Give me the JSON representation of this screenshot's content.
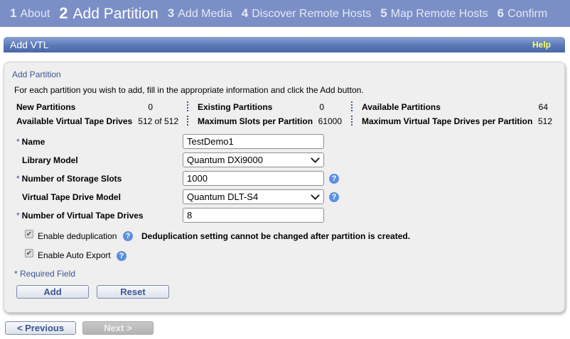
{
  "wizard": {
    "steps": [
      {
        "num": "1",
        "label": "About"
      },
      {
        "num": "2",
        "label": "Add Partition"
      },
      {
        "num": "3",
        "label": "Add Media"
      },
      {
        "num": "4",
        "label": "Discover Remote Hosts"
      },
      {
        "num": "5",
        "label": "Map Remote Hosts"
      },
      {
        "num": "6",
        "label": "Confirm"
      }
    ],
    "active_step": 2
  },
  "titlebar": {
    "title": "Add VTL",
    "help": "Help"
  },
  "panel": {
    "section_title": "Add Partition",
    "intro": "For each partition you wish to add, fill in the appropriate information and click the Add button."
  },
  "summary": {
    "new_partitions_label": "New Partitions",
    "new_partitions_value": "0",
    "existing_partitions_label": "Existing Partitions",
    "existing_partitions_value": "0",
    "available_partitions_label": "Available Partitions",
    "available_partitions_value": "64",
    "available_drives_label": "Available Virtual Tape Drives",
    "available_drives_value": "512 of 512",
    "max_slots_label": "Maximum Slots per Partition",
    "max_slots_value": "61000",
    "max_drives_label": "Maximum Virtual Tape Drives per Partition",
    "max_drives_value": "512"
  },
  "form": {
    "required_mark": "*",
    "name_label": "Name",
    "name_value": "TestDemo1",
    "library_label": "Library Model",
    "library_value": "Quantum DXi9000",
    "slots_label": "Number of Storage Slots",
    "slots_value": "1000",
    "drive_model_label": "Virtual Tape Drive Model",
    "drive_model_value": "Quantum DLT-S4",
    "drives_label": "Number of Virtual Tape Drives",
    "drives_value": "8",
    "dedup_label": "Enable deduplication",
    "dedup_checked": true,
    "dedup_note": "Deduplication setting cannot be changed after partition is created.",
    "autoexport_label": "Enable Auto Export",
    "autoexport_checked": true,
    "required_field": "* Required Field",
    "help_glyph": "?",
    "check_glyph": "✔"
  },
  "buttons": {
    "add": "Add",
    "reset": "Reset",
    "previous": "< Previous",
    "next": "Next >"
  },
  "colors": {
    "step_bar": "#7b8fc6",
    "title_bar": "#5b79b8",
    "help_text": "#ffff66",
    "accent": "#3b5690"
  }
}
